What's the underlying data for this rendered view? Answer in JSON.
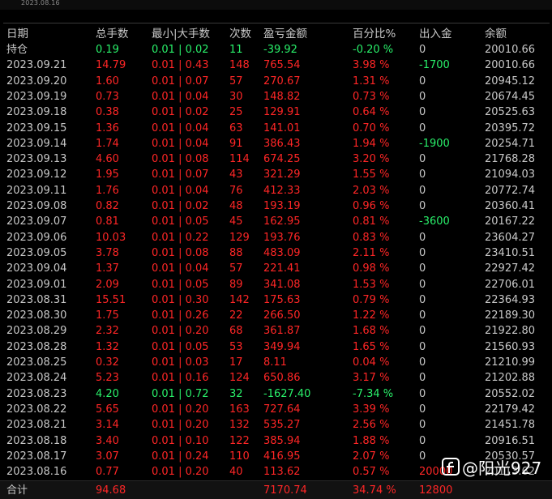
{
  "top_date": "2023.08.16",
  "headers": [
    "日期",
    "总手数",
    "最小|大手数",
    "次数",
    "盈亏金额",
    "百分比%",
    "出入金",
    "余额"
  ],
  "colors": {
    "profit": "#ff2626",
    "loss": "#29f06a",
    "neutral": "#c8c8c8"
  },
  "rows": [
    {
      "date": "持仓",
      "lots": "0.19",
      "minmax": "0.01 | 0.02",
      "count": "11",
      "pnl": "-39.92",
      "pct": "-0.20 %",
      "flow": "0",
      "balance": "20010.66",
      "tone": "green",
      "flow_tone": "light"
    },
    {
      "date": "2023.09.21",
      "lots": "14.79",
      "minmax": "0.01 | 0.43",
      "count": "148",
      "pnl": "765.54",
      "pct": "3.98 %",
      "flow": "-1700",
      "balance": "20010.66",
      "tone": "red",
      "flow_tone": "green"
    },
    {
      "date": "2023.09.20",
      "lots": "1.60",
      "minmax": "0.01 | 0.07",
      "count": "57",
      "pnl": "270.67",
      "pct": "1.31 %",
      "flow": "0",
      "balance": "20945.12",
      "tone": "red",
      "flow_tone": "light"
    },
    {
      "date": "2023.09.19",
      "lots": "0.73",
      "minmax": "0.01 | 0.04",
      "count": "30",
      "pnl": "148.82",
      "pct": "0.73 %",
      "flow": "0",
      "balance": "20674.45",
      "tone": "red",
      "flow_tone": "light"
    },
    {
      "date": "2023.09.18",
      "lots": "0.38",
      "minmax": "0.01 | 0.02",
      "count": "25",
      "pnl": "129.91",
      "pct": "0.64 %",
      "flow": "0",
      "balance": "20525.63",
      "tone": "red",
      "flow_tone": "light"
    },
    {
      "date": "2023.09.15",
      "lots": "1.36",
      "minmax": "0.01 | 0.04",
      "count": "63",
      "pnl": "141.01",
      "pct": "0.70 %",
      "flow": "0",
      "balance": "20395.72",
      "tone": "red",
      "flow_tone": "light"
    },
    {
      "date": "2023.09.14",
      "lots": "1.74",
      "minmax": "0.01 | 0.04",
      "count": "91",
      "pnl": "386.43",
      "pct": "1.94 %",
      "flow": "-1900",
      "balance": "20254.71",
      "tone": "red",
      "flow_tone": "green"
    },
    {
      "date": "2023.09.13",
      "lots": "4.60",
      "minmax": "0.01 | 0.08",
      "count": "114",
      "pnl": "674.25",
      "pct": "3.20 %",
      "flow": "0",
      "balance": "21768.28",
      "tone": "red",
      "flow_tone": "light"
    },
    {
      "date": "2023.09.12",
      "lots": "1.95",
      "minmax": "0.01 | 0.07",
      "count": "43",
      "pnl": "321.29",
      "pct": "1.55 %",
      "flow": "0",
      "balance": "21094.03",
      "tone": "red",
      "flow_tone": "light"
    },
    {
      "date": "2023.09.11",
      "lots": "1.76",
      "minmax": "0.01 | 0.04",
      "count": "76",
      "pnl": "412.33",
      "pct": "2.03 %",
      "flow": "0",
      "balance": "20772.74",
      "tone": "red",
      "flow_tone": "light"
    },
    {
      "date": "2023.09.08",
      "lots": "0.82",
      "minmax": "0.01 | 0.02",
      "count": "48",
      "pnl": "193.19",
      "pct": "0.96 %",
      "flow": "0",
      "balance": "20360.41",
      "tone": "red",
      "flow_tone": "light"
    },
    {
      "date": "2023.09.07",
      "lots": "0.81",
      "minmax": "0.01 | 0.05",
      "count": "45",
      "pnl": "162.95",
      "pct": "0.81 %",
      "flow": "-3600",
      "balance": "20167.22",
      "tone": "red",
      "flow_tone": "green"
    },
    {
      "date": "2023.09.06",
      "lots": "10.03",
      "minmax": "0.01 | 0.22",
      "count": "129",
      "pnl": "193.76",
      "pct": "0.83 %",
      "flow": "0",
      "balance": "23604.27",
      "tone": "red",
      "flow_tone": "light"
    },
    {
      "date": "2023.09.05",
      "lots": "3.78",
      "minmax": "0.01 | 0.08",
      "count": "88",
      "pnl": "483.09",
      "pct": "2.11 %",
      "flow": "0",
      "balance": "23410.51",
      "tone": "red",
      "flow_tone": "light"
    },
    {
      "date": "2023.09.04",
      "lots": "1.37",
      "minmax": "0.01 | 0.04",
      "count": "57",
      "pnl": "221.41",
      "pct": "0.98 %",
      "flow": "0",
      "balance": "22927.42",
      "tone": "red",
      "flow_tone": "light"
    },
    {
      "date": "2023.09.01",
      "lots": "2.09",
      "minmax": "0.01 | 0.05",
      "count": "89",
      "pnl": "341.08",
      "pct": "1.53 %",
      "flow": "0",
      "balance": "22706.01",
      "tone": "red",
      "flow_tone": "light"
    },
    {
      "date": "2023.08.31",
      "lots": "15.51",
      "minmax": "0.01 | 0.30",
      "count": "142",
      "pnl": "175.63",
      "pct": "0.79 %",
      "flow": "0",
      "balance": "22364.93",
      "tone": "red",
      "flow_tone": "light"
    },
    {
      "date": "2023.08.30",
      "lots": "1.75",
      "minmax": "0.01 | 0.26",
      "count": "22",
      "pnl": "266.50",
      "pct": "1.22 %",
      "flow": "0",
      "balance": "22189.30",
      "tone": "red",
      "flow_tone": "light"
    },
    {
      "date": "2023.08.29",
      "lots": "2.32",
      "minmax": "0.01 | 0.20",
      "count": "68",
      "pnl": "361.87",
      "pct": "1.68 %",
      "flow": "0",
      "balance": "21922.80",
      "tone": "red",
      "flow_tone": "light"
    },
    {
      "date": "2023.08.28",
      "lots": "1.32",
      "minmax": "0.01 | 0.05",
      "count": "53",
      "pnl": "349.94",
      "pct": "1.65 %",
      "flow": "0",
      "balance": "21560.93",
      "tone": "red",
      "flow_tone": "light"
    },
    {
      "date": "2023.08.25",
      "lots": "0.32",
      "minmax": "0.01 | 0.03",
      "count": "17",
      "pnl": "8.11",
      "pct": "0.04 %",
      "flow": "0",
      "balance": "21210.99",
      "tone": "red",
      "flow_tone": "light"
    },
    {
      "date": "2023.08.24",
      "lots": "5.23",
      "minmax": "0.01 | 0.16",
      "count": "124",
      "pnl": "650.86",
      "pct": "3.17 %",
      "flow": "0",
      "balance": "21202.88",
      "tone": "red",
      "flow_tone": "light"
    },
    {
      "date": "2023.08.23",
      "lots": "4.20",
      "minmax": "0.01 | 0.72",
      "count": "32",
      "pnl": "-1627.40",
      "pct": "-7.34 %",
      "flow": "0",
      "balance": "20552.02",
      "tone": "green",
      "flow_tone": "light"
    },
    {
      "date": "2023.08.22",
      "lots": "5.65",
      "minmax": "0.01 | 0.20",
      "count": "163",
      "pnl": "727.64",
      "pct": "3.39 %",
      "flow": "0",
      "balance": "22179.42",
      "tone": "red",
      "flow_tone": "light"
    },
    {
      "date": "2023.08.21",
      "lots": "3.14",
      "minmax": "0.01 | 0.20",
      "count": "132",
      "pnl": "535.27",
      "pct": "2.56 %",
      "flow": "0",
      "balance": "21451.78",
      "tone": "red",
      "flow_tone": "light"
    },
    {
      "date": "2023.08.18",
      "lots": "3.40",
      "minmax": "0.01 | 0.10",
      "count": "122",
      "pnl": "385.94",
      "pct": "1.88 %",
      "flow": "0",
      "balance": "20916.51",
      "tone": "red",
      "flow_tone": "light"
    },
    {
      "date": "2023.08.17",
      "lots": "3.07",
      "minmax": "0.01 | 0.24",
      "count": "110",
      "pnl": "416.95",
      "pct": "2.07 %",
      "flow": "0",
      "balance": "20530.57",
      "tone": "red",
      "flow_tone": "light"
    },
    {
      "date": "2023.08.16",
      "lots": "0.77",
      "minmax": "0.01 | 0.20",
      "count": "40",
      "pnl": "113.62",
      "pct": "0.57 %",
      "flow": "20000",
      "balance": "20113.62",
      "tone": "red",
      "flow_tone": "red"
    }
  ],
  "total": {
    "label": "合计",
    "lots": "94.68",
    "pnl": "7170.74",
    "pct": "34.74 %",
    "flow": "12800"
  },
  "watermark": {
    "icon": "facebook-icon",
    "text": "@阳光927"
  }
}
